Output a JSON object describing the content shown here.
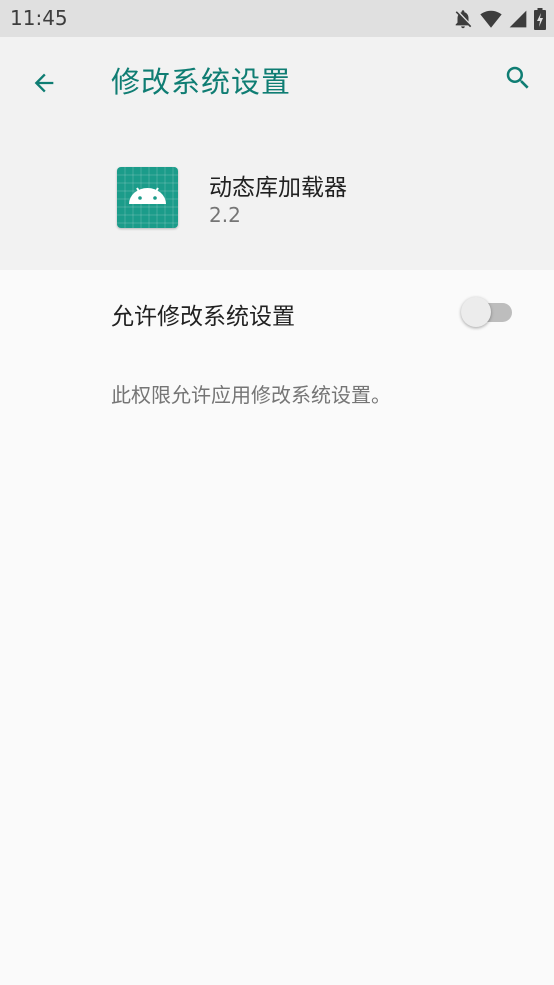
{
  "status_bar": {
    "time": "11:45",
    "icons": [
      "notifications-off-icon",
      "wifi-icon",
      "cell-signal-icon",
      "battery-charging-icon"
    ]
  },
  "header": {
    "title": "修改系统设置",
    "back_icon": "arrow-back-icon",
    "search_icon": "search-icon"
  },
  "app_info": {
    "name": "动态库加载器",
    "version": "2.2",
    "icon": "android-app-icon"
  },
  "setting": {
    "label": "允许修改系统设置",
    "enabled": false
  },
  "description": "此权限允许应用修改系统设置。",
  "colors": {
    "accent": "#0f7d73",
    "app_icon_bg": "#1b9c8a",
    "header_bg": "#f2f2f2",
    "page_bg": "#fafafa",
    "status_bar_bg": "#e0e0e0"
  }
}
